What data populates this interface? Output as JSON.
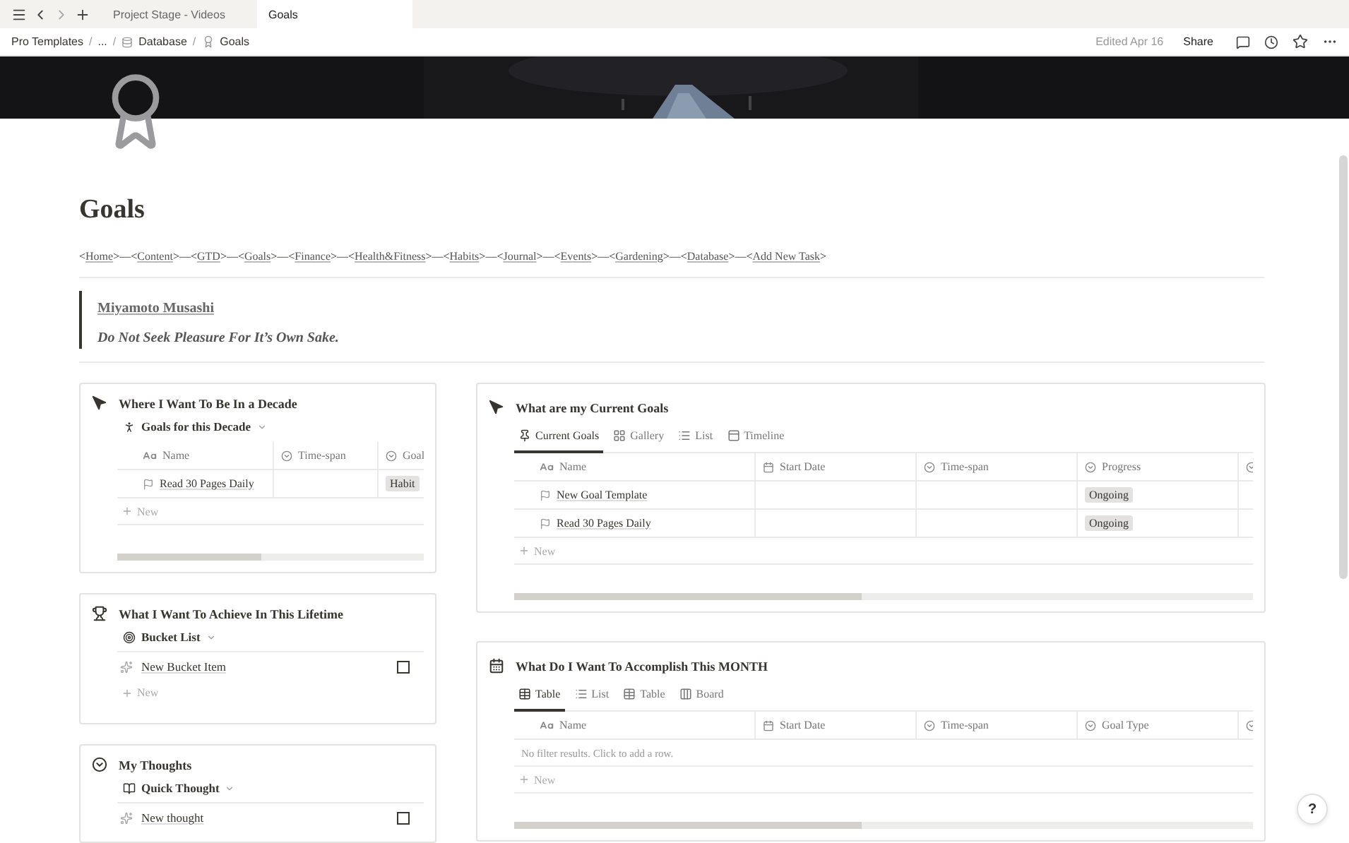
{
  "tabs": [
    {
      "label": "Project Stage - Videos",
      "selected": false
    },
    {
      "label": "Goals",
      "selected": true
    }
  ],
  "breadcrumb": {
    "separator": "/",
    "items": [
      "Pro Templates",
      "...",
      "Database",
      "Goals"
    ]
  },
  "topbar": {
    "edited": "Edited Apr 16",
    "share": "Share"
  },
  "title": "Goals",
  "nav": {
    "open": "<",
    "close": ">",
    "separator": "—",
    "links": [
      "Home",
      "Content",
      "GTD",
      "Goals",
      "Finance",
      "Health&Fitness",
      "Habits",
      "Journal",
      "Events",
      "Gardening",
      "Database",
      "Add New Task"
    ]
  },
  "quote": {
    "author": "Miyamoto Musashi",
    "text": "Do Not Seek Pleasure For It’s Own Sake."
  },
  "left_blocks": [
    {
      "kind": "table",
      "title": "Where I Want To Be In a Decade",
      "view": "Goals for this Decade",
      "columns": [
        {
          "kind": "title",
          "label": "Name"
        },
        {
          "kind": "select",
          "label": "Time-span"
        },
        {
          "kind": "select",
          "label": "Goal"
        }
      ],
      "rows": [
        {
          "cells": [
            "Read 30 Pages Daily",
            "",
            "Habit"
          ]
        }
      ],
      "new_label": "New"
    },
    {
      "kind": "list",
      "title": "What I Want To Achieve In This Lifetime",
      "view": "Bucket List",
      "items": [
        {
          "label": "New Bucket Item",
          "checked": false
        }
      ],
      "new_label": "New"
    },
    {
      "kind": "list",
      "title": "My Thoughts",
      "view": "Quick Thought",
      "items": [
        {
          "label": "New thought",
          "checked": false
        }
      ]
    }
  ],
  "right_blocks": [
    {
      "title": "What are my Current Goals",
      "views": [
        {
          "label": "Current Goals",
          "selected": true
        },
        {
          "label": "Gallery",
          "selected": false
        },
        {
          "label": "List",
          "selected": false
        },
        {
          "label": "Timeline",
          "selected": false
        }
      ],
      "columns": [
        {
          "kind": "title",
          "label": "Name"
        },
        {
          "kind": "date",
          "label": "Start Date"
        },
        {
          "kind": "select",
          "label": "Time-span"
        },
        {
          "kind": "select",
          "label": "Progress"
        },
        {
          "kind": "select"
        }
      ],
      "rows": [
        {
          "cells": [
            "New Goal Template",
            "",
            "",
            "Ongoing"
          ]
        },
        {
          "cells": [
            "Read 30 Pages Daily",
            "",
            "",
            "Ongoing"
          ]
        }
      ],
      "new_label": "New"
    },
    {
      "title": "What Do I Want To Accomplish This MONTH",
      "views": [
        {
          "label": "Table",
          "selected": true
        },
        {
          "label": "List",
          "selected": false
        },
        {
          "label": "Table",
          "selected": false
        },
        {
          "label": "Board",
          "selected": false
        }
      ],
      "columns": [
        {
          "kind": "title",
          "label": "Name"
        },
        {
          "kind": "date",
          "label": "Start Date"
        },
        {
          "kind": "select",
          "label": "Time-span"
        },
        {
          "kind": "select",
          "label": "Goal Type"
        },
        {
          "kind": "select"
        }
      ],
      "empty": "No filter results. Click to add a row.",
      "new_label": "New"
    }
  ],
  "help": "?"
}
